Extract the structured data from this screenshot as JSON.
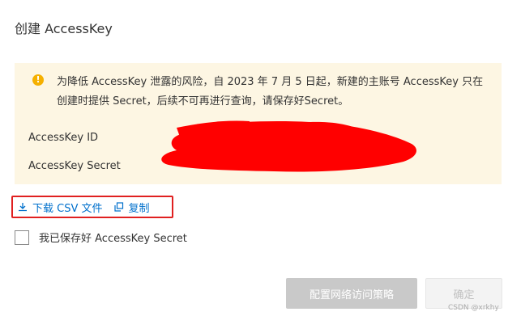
{
  "dialog": {
    "title": "创建 AccessKey"
  },
  "warning": {
    "icon": "warning-icon",
    "color": "#f5b000",
    "text": "为降低 AccessKey 泄露的风险，自 2023 年 7 月 5 日起，新建的主账号 AccessKey 只在创建时提供 Secret，后续不可再进行查询，请保存好Secret。"
  },
  "credentials": {
    "id_label": "AccessKey ID",
    "secret_label": "AccessKey Secret"
  },
  "actions": {
    "download_label": "下载 CSV 文件",
    "copy_label": "复制"
  },
  "confirm_checkbox": {
    "label": "我已保存好 AccessKey Secret",
    "checked": false
  },
  "footer": {
    "primary_label": "配置网络访问策略",
    "secondary_label": "确定"
  },
  "watermark": "CSDN @xrkhy"
}
